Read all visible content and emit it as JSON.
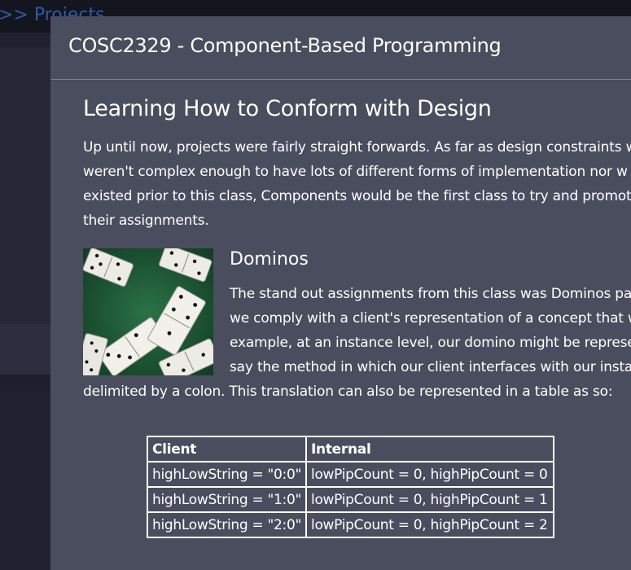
{
  "background": {
    "breadcrumb": ">> Projects"
  },
  "modal": {
    "title": "COSC2329 - Component-Based Programming"
  },
  "section": {
    "heading": "Learning How to Conform with Design",
    "paragraph_lines": [
      "Up until now, projects were fairly straight forwards. As far as design constraints w",
      "weren't complex enough to have lots of different forms of implementation nor w",
      "existed prior to this class, Components would be the first class to try and promot",
      "their assignments."
    ]
  },
  "dominos": {
    "image_name": "domino-photo",
    "heading": "Dominos",
    "paragraph_lines": [
      "The stand out assignments from this class was Dominos pa",
      "we comply with a client's representation of a concept that w",
      "example, at an instance level, our domino might be represe",
      "say the method in which our client interfaces with our insta"
    ],
    "last_line": "delimited by a colon. This translation can also be represented in a table as so:"
  },
  "table": {
    "headers": [
      "Client",
      "Internal"
    ],
    "rows": [
      [
        "highLowString = \"0:0\"",
        "lowPipCount = 0, highPipCount = 0"
      ],
      [
        "highLowString = \"1:0\"",
        "lowPipCount = 0, highPipCount = 1"
      ],
      [
        "highLowString = \"2:0\"",
        "lowPipCount = 0, highPipCount = 2"
      ]
    ]
  },
  "colors": {
    "modal_bg": "#4a4d5e",
    "page_bg": "#1b1d2a",
    "breadcrumb": "#2d5aa8",
    "image_felt": "#1f5a36"
  }
}
